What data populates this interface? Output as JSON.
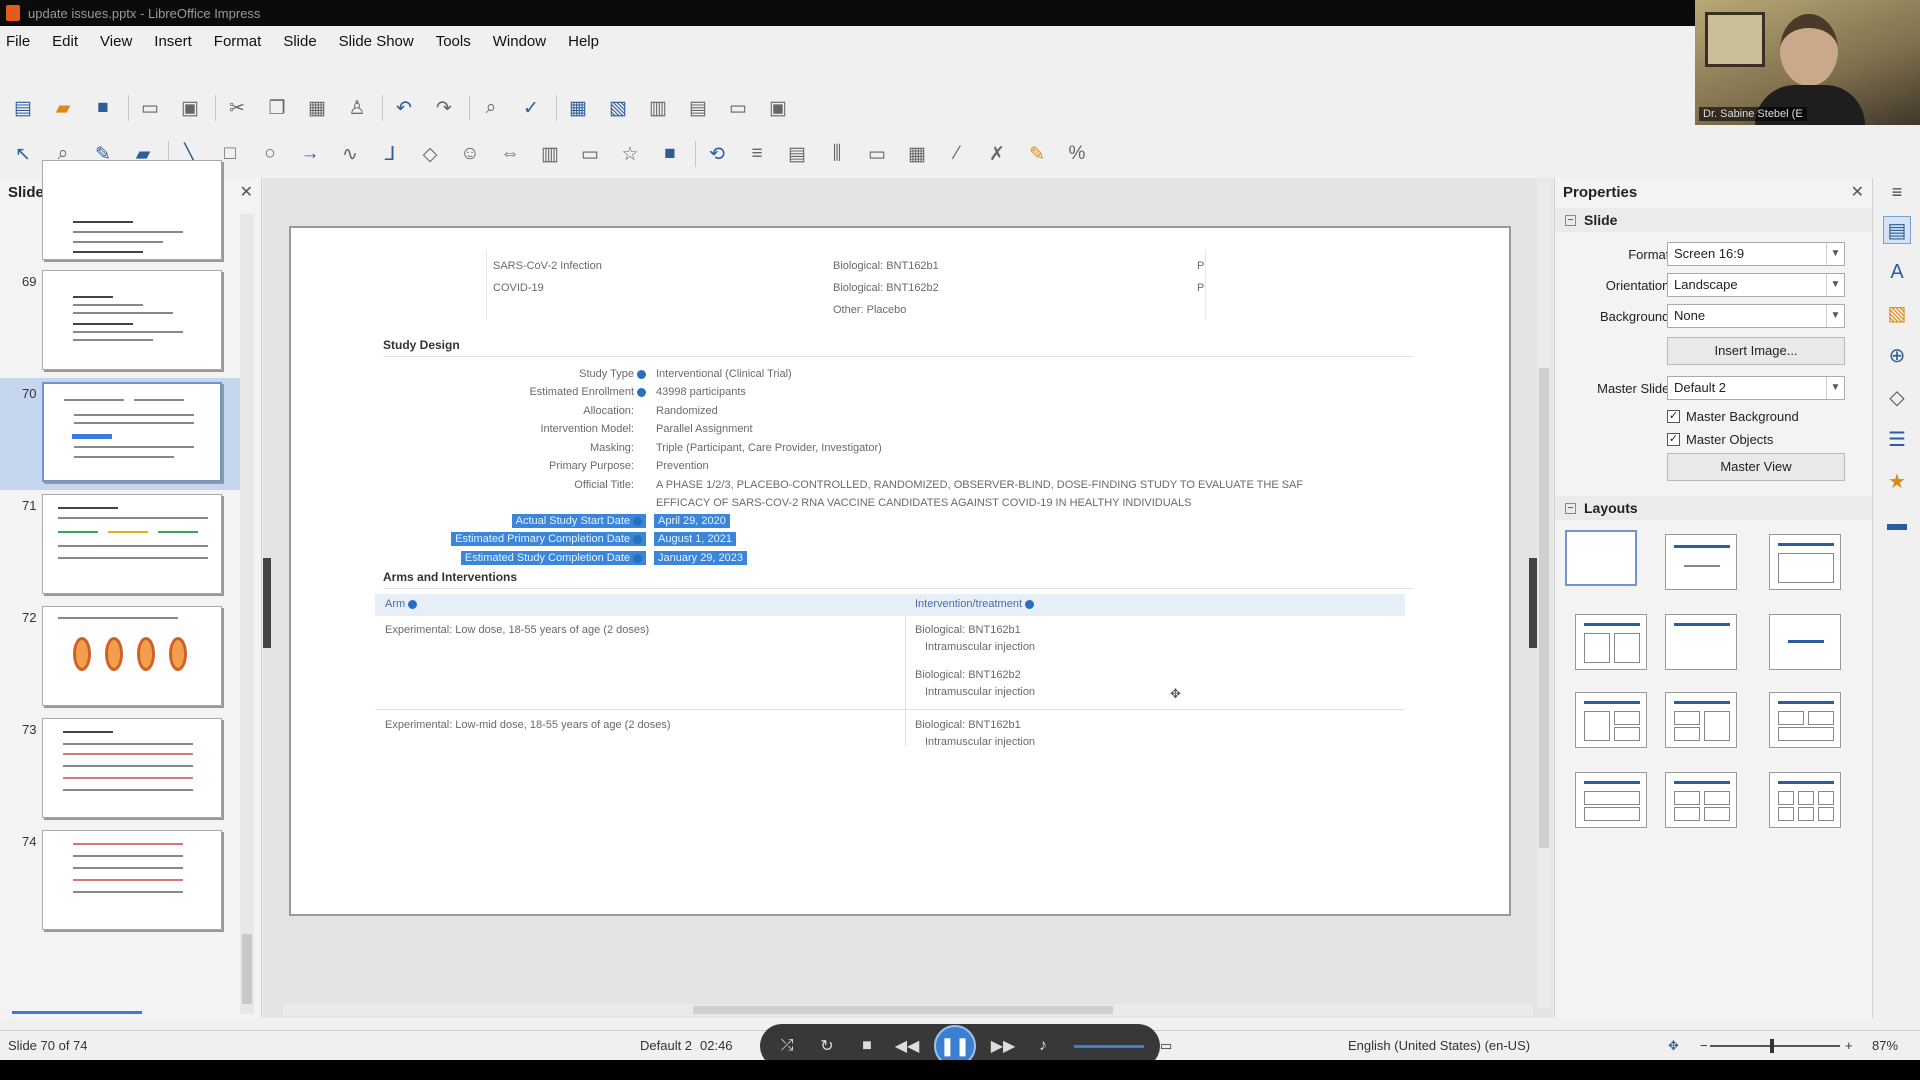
{
  "window": {
    "title": "update issues.pptx - LibreOffice Impress",
    "close_glyph": "✕"
  },
  "webcam": {
    "name": "Dr. Sabine Stebel (E"
  },
  "menu": [
    "File",
    "Edit",
    "View",
    "Insert",
    "Format",
    "Slide",
    "Slide Show",
    "Tools",
    "Window",
    "Help"
  ],
  "slides_pane": {
    "title": "Slides",
    "numbers": [
      "69",
      "70",
      "71",
      "72",
      "73",
      "74"
    ],
    "current": "70"
  },
  "slide": {
    "conditions": [
      "SARS-CoV-2 Infection",
      "COVID-19"
    ],
    "interventions": [
      "Biological: BNT162b1",
      "Biological: BNT162b2",
      "Other: Placebo"
    ],
    "trunc": [
      "P",
      "P"
    ],
    "study_design_heading": "Study Design",
    "design_labels": [
      "Study Type",
      "Estimated Enrollment",
      "Allocation:",
      "Intervention Model:",
      "Masking:",
      "Primary Purpose:",
      "Official Title:"
    ],
    "design_values": [
      "Interventional  (Clinical Trial)",
      "43998 participants",
      "Randomized",
      "Parallel Assignment",
      "Triple (Participant, Care Provider, Investigator)",
      "Prevention",
      "A PHASE 1/2/3, PLACEBO-CONTROLLED, RANDOMIZED, OBSERVER-BLIND, DOSE-FINDING STUDY TO EVALUATE THE SAF"
    ],
    "official_title_line2": "EFFICACY OF SARS-COV-2 RNA VACCINE CANDIDATES AGAINST COVID-19 IN HEALTHY INDIVIDUALS",
    "date_labels": [
      "Actual Study Start Date",
      "Estimated Primary Completion Date",
      "Estimated Study Completion Date"
    ],
    "date_values": [
      "April 29, 2020",
      "August 1, 2021",
      "January 29, 2023"
    ],
    "arms_heading": "Arms and Interventions",
    "arms_col1": "Arm",
    "arms_col2": "Intervention/treatment",
    "arm_rows": [
      {
        "arm": "Experimental: Low dose, 18-55 years of age (2 doses)",
        "treatments": [
          "Biological: BNT162b1",
          "Intramuscular injection",
          "Biological: BNT162b2",
          "Intramuscular injection"
        ]
      },
      {
        "arm": "Experimental: Low-mid dose, 18-55 years of age (2 doses)",
        "treatments": [
          "Biological: BNT162b1",
          "Intramuscular injection"
        ]
      }
    ]
  },
  "properties": {
    "title": "Properties",
    "slide_section": "Slide",
    "format_label": "Format:",
    "format_value": "Screen 16:9",
    "orientation_label": "Orientation:",
    "orientation_value": "Landscape",
    "background_label": "Background:",
    "background_value": "None",
    "insert_image": "Insert Image...",
    "master_slide_label": "Master Slide:",
    "master_slide_value": "Default 2",
    "master_background": "Master Background",
    "master_objects": "Master Objects",
    "master_view": "Master View",
    "layouts_section": "Layouts",
    "checked_glyph": "✓",
    "collapse_glyph": "−"
  },
  "status": {
    "slide_info": "Slide 70 of 74",
    "master_info": "Default 2",
    "time": "02:46",
    "language": "English (United States) (en-US)",
    "zoom": "87%"
  },
  "player": {
    "play_state": "playing"
  },
  "colors": {
    "selection": "#3a86d8",
    "accent": "#2d5d9b",
    "title_bar": "#0b0b0b"
  }
}
